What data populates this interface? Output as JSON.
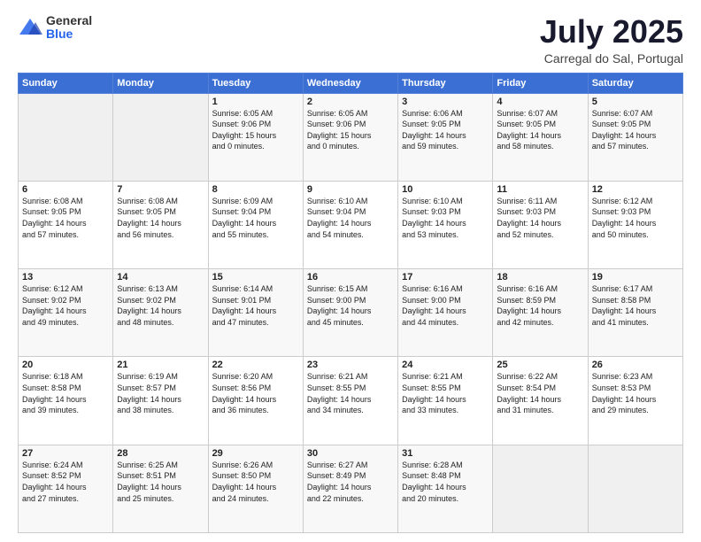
{
  "logo": {
    "general": "General",
    "blue": "Blue"
  },
  "header": {
    "title": "July 2025",
    "subtitle": "Carregal do Sal, Portugal"
  },
  "weekdays": [
    "Sunday",
    "Monday",
    "Tuesday",
    "Wednesday",
    "Thursday",
    "Friday",
    "Saturday"
  ],
  "rows": [
    [
      {
        "day": "",
        "info": ""
      },
      {
        "day": "",
        "info": ""
      },
      {
        "day": "1",
        "info": "Sunrise: 6:05 AM\nSunset: 9:06 PM\nDaylight: 15 hours\nand 0 minutes."
      },
      {
        "day": "2",
        "info": "Sunrise: 6:05 AM\nSunset: 9:06 PM\nDaylight: 15 hours\nand 0 minutes."
      },
      {
        "day": "3",
        "info": "Sunrise: 6:06 AM\nSunset: 9:05 PM\nDaylight: 14 hours\nand 59 minutes."
      },
      {
        "day": "4",
        "info": "Sunrise: 6:07 AM\nSunset: 9:05 PM\nDaylight: 14 hours\nand 58 minutes."
      },
      {
        "day": "5",
        "info": "Sunrise: 6:07 AM\nSunset: 9:05 PM\nDaylight: 14 hours\nand 57 minutes."
      }
    ],
    [
      {
        "day": "6",
        "info": "Sunrise: 6:08 AM\nSunset: 9:05 PM\nDaylight: 14 hours\nand 57 minutes."
      },
      {
        "day": "7",
        "info": "Sunrise: 6:08 AM\nSunset: 9:05 PM\nDaylight: 14 hours\nand 56 minutes."
      },
      {
        "day": "8",
        "info": "Sunrise: 6:09 AM\nSunset: 9:04 PM\nDaylight: 14 hours\nand 55 minutes."
      },
      {
        "day": "9",
        "info": "Sunrise: 6:10 AM\nSunset: 9:04 PM\nDaylight: 14 hours\nand 54 minutes."
      },
      {
        "day": "10",
        "info": "Sunrise: 6:10 AM\nSunset: 9:03 PM\nDaylight: 14 hours\nand 53 minutes."
      },
      {
        "day": "11",
        "info": "Sunrise: 6:11 AM\nSunset: 9:03 PM\nDaylight: 14 hours\nand 52 minutes."
      },
      {
        "day": "12",
        "info": "Sunrise: 6:12 AM\nSunset: 9:03 PM\nDaylight: 14 hours\nand 50 minutes."
      }
    ],
    [
      {
        "day": "13",
        "info": "Sunrise: 6:12 AM\nSunset: 9:02 PM\nDaylight: 14 hours\nand 49 minutes."
      },
      {
        "day": "14",
        "info": "Sunrise: 6:13 AM\nSunset: 9:02 PM\nDaylight: 14 hours\nand 48 minutes."
      },
      {
        "day": "15",
        "info": "Sunrise: 6:14 AM\nSunset: 9:01 PM\nDaylight: 14 hours\nand 47 minutes."
      },
      {
        "day": "16",
        "info": "Sunrise: 6:15 AM\nSunset: 9:00 PM\nDaylight: 14 hours\nand 45 minutes."
      },
      {
        "day": "17",
        "info": "Sunrise: 6:16 AM\nSunset: 9:00 PM\nDaylight: 14 hours\nand 44 minutes."
      },
      {
        "day": "18",
        "info": "Sunrise: 6:16 AM\nSunset: 8:59 PM\nDaylight: 14 hours\nand 42 minutes."
      },
      {
        "day": "19",
        "info": "Sunrise: 6:17 AM\nSunset: 8:58 PM\nDaylight: 14 hours\nand 41 minutes."
      }
    ],
    [
      {
        "day": "20",
        "info": "Sunrise: 6:18 AM\nSunset: 8:58 PM\nDaylight: 14 hours\nand 39 minutes."
      },
      {
        "day": "21",
        "info": "Sunrise: 6:19 AM\nSunset: 8:57 PM\nDaylight: 14 hours\nand 38 minutes."
      },
      {
        "day": "22",
        "info": "Sunrise: 6:20 AM\nSunset: 8:56 PM\nDaylight: 14 hours\nand 36 minutes."
      },
      {
        "day": "23",
        "info": "Sunrise: 6:21 AM\nSunset: 8:55 PM\nDaylight: 14 hours\nand 34 minutes."
      },
      {
        "day": "24",
        "info": "Sunrise: 6:21 AM\nSunset: 8:55 PM\nDaylight: 14 hours\nand 33 minutes."
      },
      {
        "day": "25",
        "info": "Sunrise: 6:22 AM\nSunset: 8:54 PM\nDaylight: 14 hours\nand 31 minutes."
      },
      {
        "day": "26",
        "info": "Sunrise: 6:23 AM\nSunset: 8:53 PM\nDaylight: 14 hours\nand 29 minutes."
      }
    ],
    [
      {
        "day": "27",
        "info": "Sunrise: 6:24 AM\nSunset: 8:52 PM\nDaylight: 14 hours\nand 27 minutes."
      },
      {
        "day": "28",
        "info": "Sunrise: 6:25 AM\nSunset: 8:51 PM\nDaylight: 14 hours\nand 25 minutes."
      },
      {
        "day": "29",
        "info": "Sunrise: 6:26 AM\nSunset: 8:50 PM\nDaylight: 14 hours\nand 24 minutes."
      },
      {
        "day": "30",
        "info": "Sunrise: 6:27 AM\nSunset: 8:49 PM\nDaylight: 14 hours\nand 22 minutes."
      },
      {
        "day": "31",
        "info": "Sunrise: 6:28 AM\nSunset: 8:48 PM\nDaylight: 14 hours\nand 20 minutes."
      },
      {
        "day": "",
        "info": ""
      },
      {
        "day": "",
        "info": ""
      }
    ]
  ]
}
